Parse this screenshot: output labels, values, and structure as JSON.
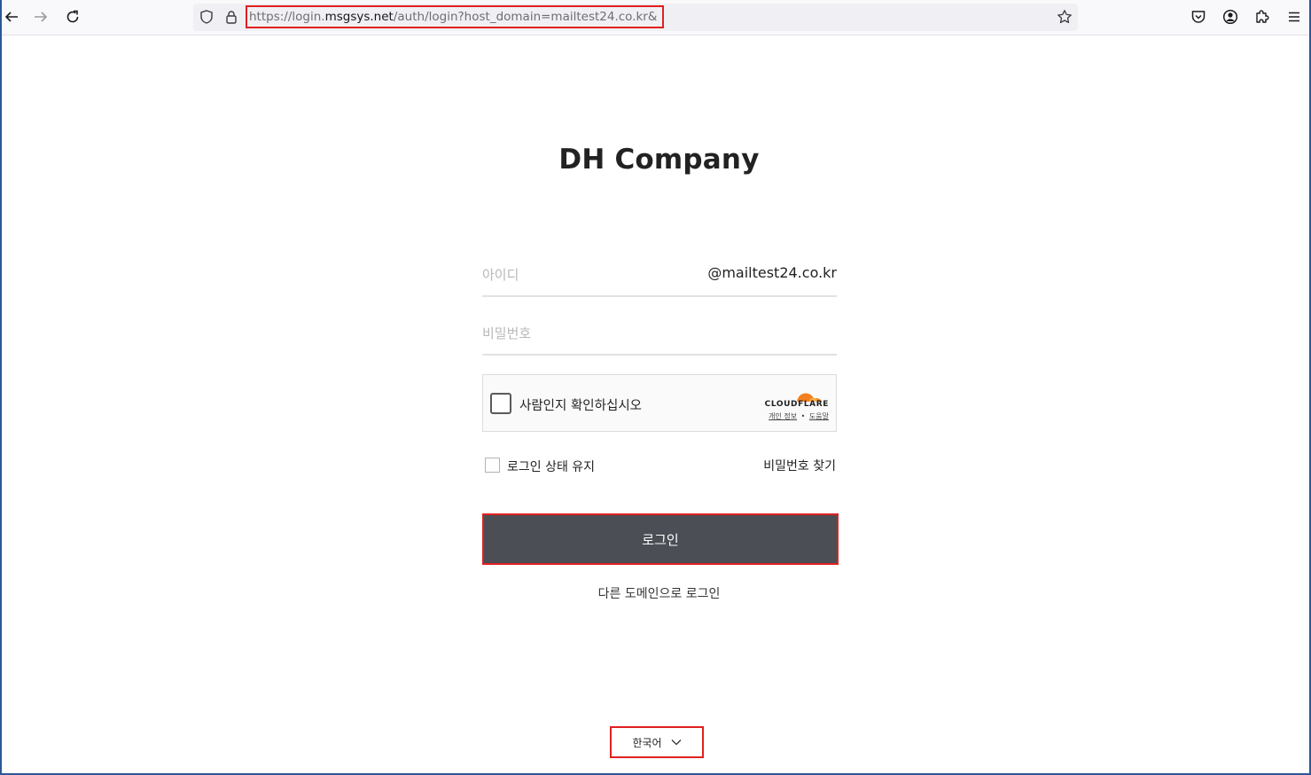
{
  "browser": {
    "url_prefix": "https://login.",
    "url_domain": "msgsys.net",
    "url_suffix": "/auth/login?host_domain=mailtest24.co.kr&",
    "icons": {
      "back": "back-arrow-icon",
      "forward": "forward-arrow-icon",
      "reload": "reload-icon",
      "shield": "shield-icon",
      "lock": "lock-icon",
      "bookmark": "star-icon",
      "pocket": "pocket-icon",
      "account": "account-icon",
      "extensions": "puzzle-icon",
      "menu": "hamburger-menu-icon"
    }
  },
  "page": {
    "title": "DH Company",
    "id_placeholder": "아이디",
    "id_domain_suffix": "@mailtest24.co.kr",
    "password_placeholder": "비밀번호",
    "captcha": {
      "label": "사람인지 확인하십시오",
      "brand": "CLOUDFLARE",
      "privacy": "개인 정보",
      "separator": "•",
      "help": "도움말"
    },
    "keep_login_label": "로그인 상태 유지",
    "find_password_label": "비밀번호 찾기",
    "login_button_label": "로그인",
    "other_domain_link": "다른 도메인으로 로그인",
    "language": "한국어"
  },
  "colors": {
    "login_button_bg": "#4b4e55",
    "highlight_border": "#e02020",
    "cloudflare_orange": "#f38020"
  }
}
